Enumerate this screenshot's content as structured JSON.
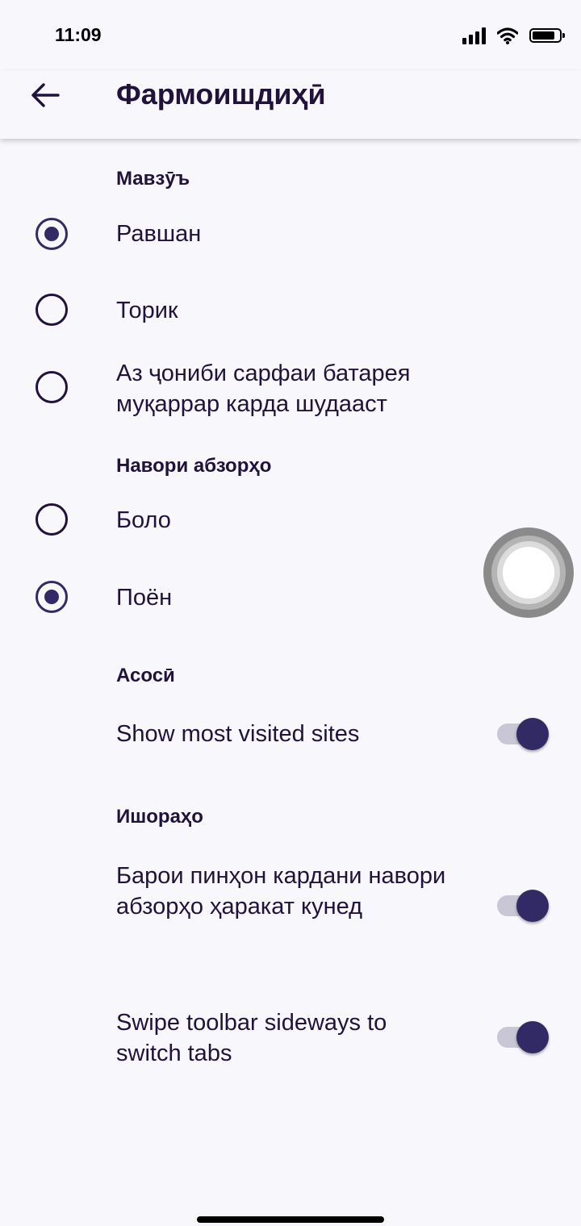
{
  "status_bar": {
    "time": "11:09",
    "icons": [
      "signal-icon",
      "wifi-icon",
      "battery-icon"
    ]
  },
  "app_bar": {
    "back_icon": "arrow-left-icon",
    "title": "Фармоишдиҳӣ"
  },
  "sections": {
    "theme": {
      "header": "Мавзӯъ",
      "options": [
        {
          "label": "Равшан",
          "selected": true
        },
        {
          "label": "Торик",
          "selected": false
        },
        {
          "label": "Аз ҷониби сарфаи батарея муқаррар карда шудааст",
          "selected": false
        }
      ]
    },
    "toolbar": {
      "header": "Навори абзорҳо",
      "options": [
        {
          "label": "Боло",
          "selected": false
        },
        {
          "label": "Поён",
          "selected": true
        }
      ]
    },
    "general": {
      "header": "Асосӣ",
      "items": [
        {
          "label": "Show most visited sites",
          "enabled": true
        }
      ]
    },
    "gestures": {
      "header": "Ишораҳо",
      "items": [
        {
          "label": "Барои пинҳон кардани навори абзорҳо ҳаракат кунед",
          "enabled": true
        },
        {
          "label": "Swipe toolbar sideways to switch tabs",
          "enabled": true
        }
      ]
    }
  },
  "colors": {
    "accent": "#312a65",
    "text": "#20123a",
    "background": "#f8f7fb",
    "switch_track": "#c9c6d5"
  }
}
